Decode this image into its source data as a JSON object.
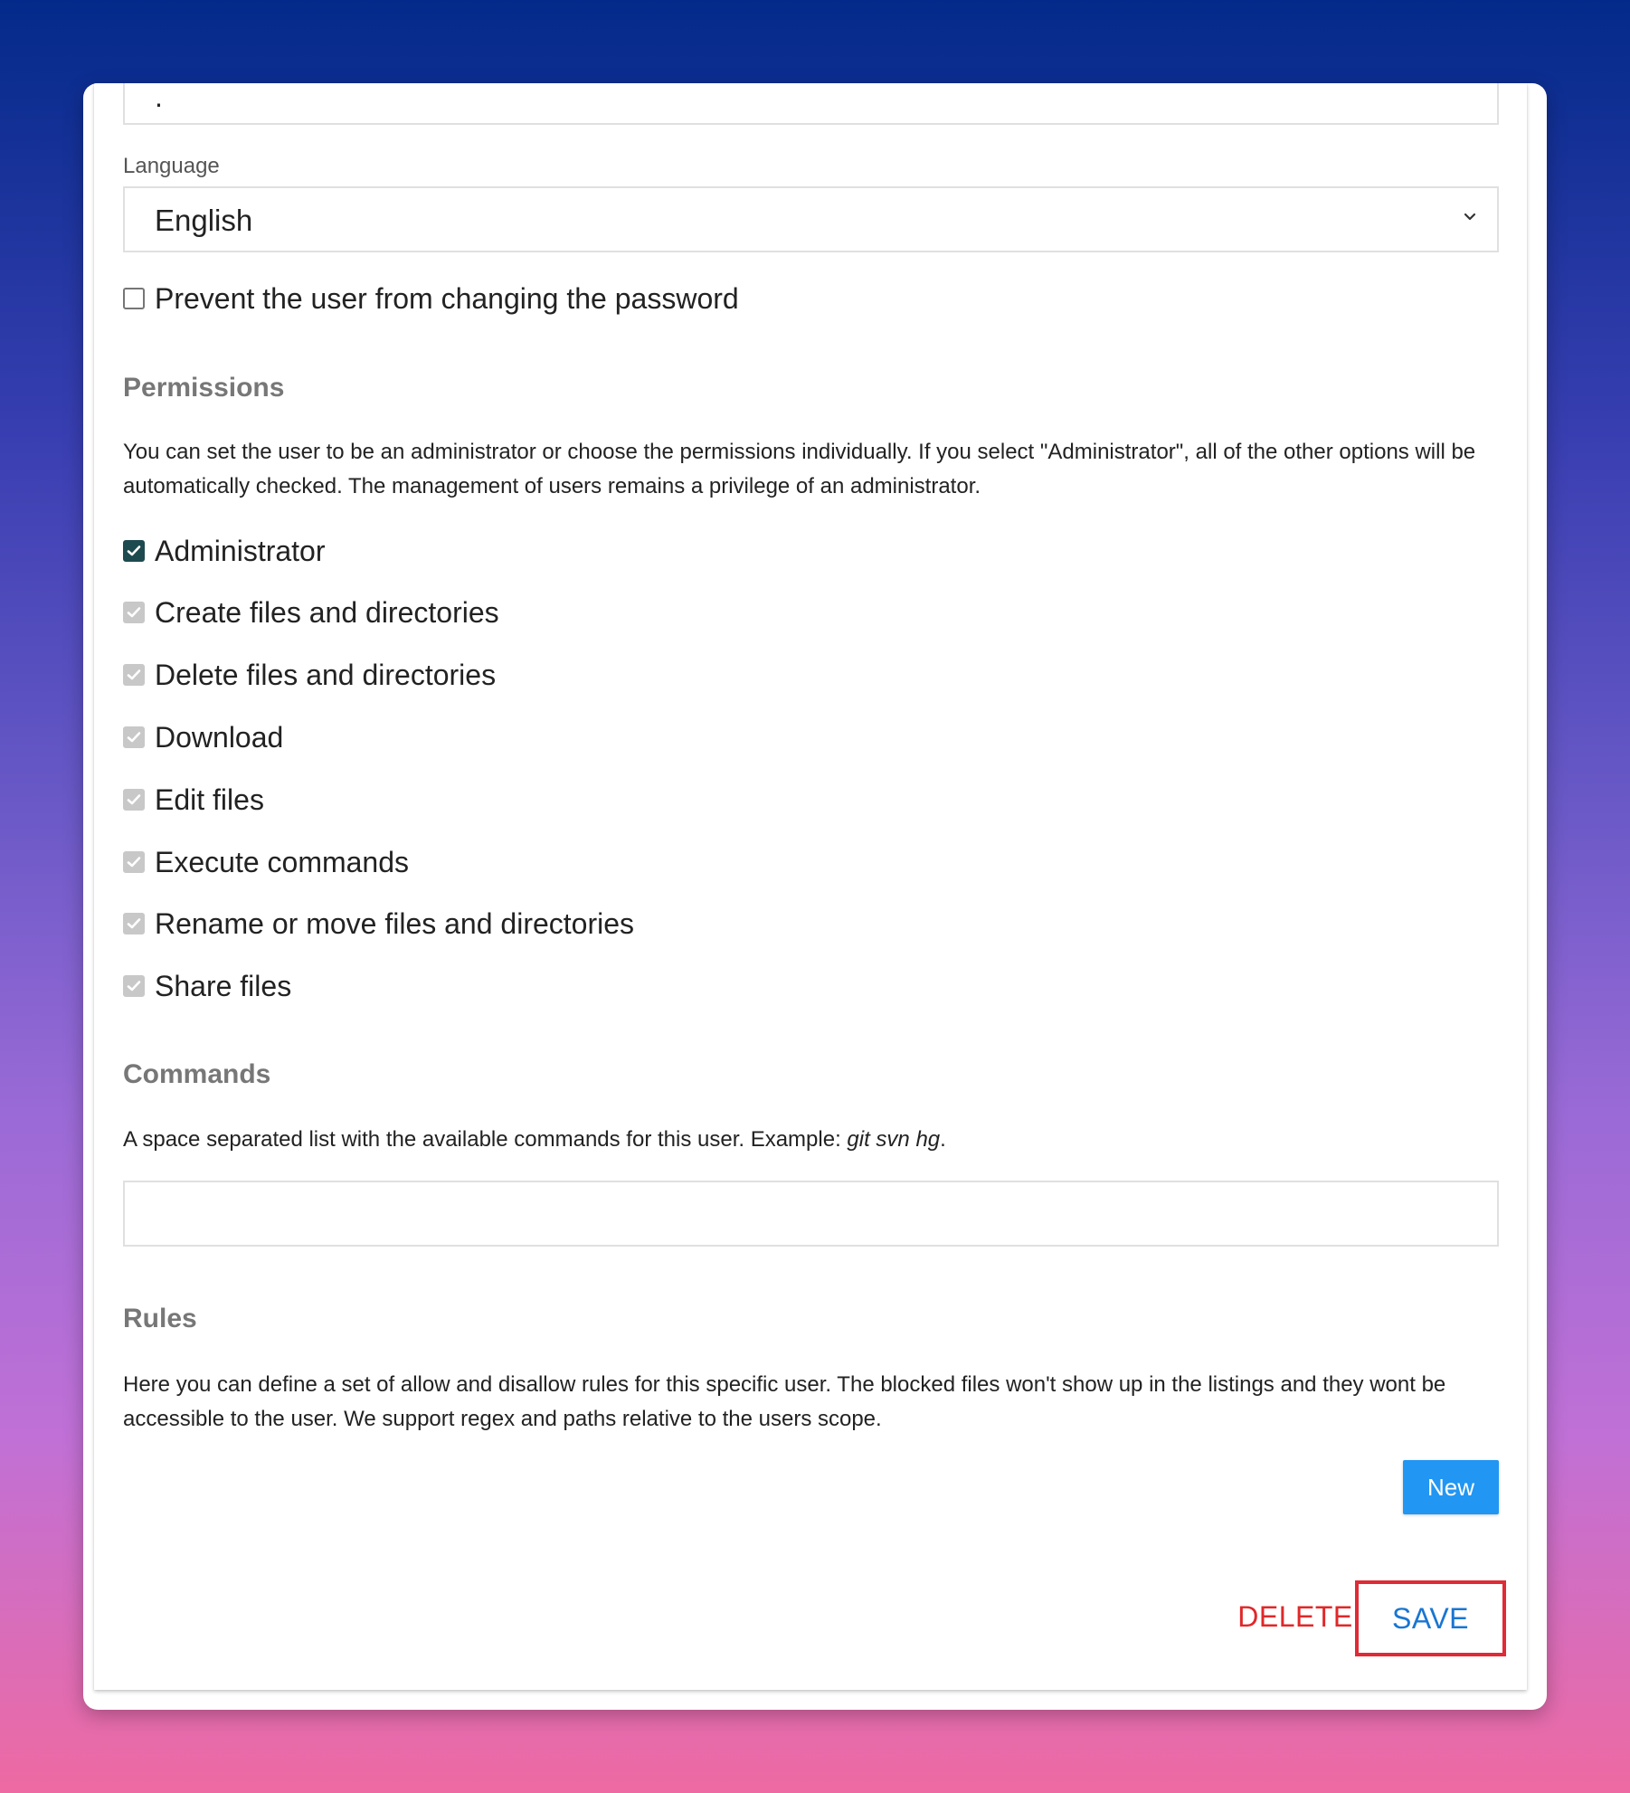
{
  "scope_input": {
    "value": "."
  },
  "language": {
    "label": "Language",
    "selected": "English",
    "icon": "chevron-down-icon"
  },
  "prevent_password_change": {
    "label": "Prevent the user from changing the password",
    "checked": false
  },
  "permissions": {
    "title": "Permissions",
    "description": "You can set the user to be an administrator or choose the permissions individually. If you select \"Administrator\", all of the other options will be automatically checked. The management of users remains a privilege of an administrator.",
    "items": [
      {
        "label": "Administrator",
        "checked": true,
        "disabled": false
      },
      {
        "label": "Create files and directories",
        "checked": true,
        "disabled": true
      },
      {
        "label": "Delete files and directories",
        "checked": true,
        "disabled": true
      },
      {
        "label": "Download",
        "checked": true,
        "disabled": true
      },
      {
        "label": "Edit files",
        "checked": true,
        "disabled": true
      },
      {
        "label": "Execute commands",
        "checked": true,
        "disabled": true
      },
      {
        "label": "Rename or move files and directories",
        "checked": true,
        "disabled": true
      },
      {
        "label": "Share files",
        "checked": true,
        "disabled": true
      }
    ]
  },
  "commands": {
    "title": "Commands",
    "description_prefix": "A space separated list with the available commands for this user. Example: ",
    "example": "git svn hg",
    "description_suffix": ".",
    "value": ""
  },
  "rules": {
    "title": "Rules",
    "description": "Here you can define a set of allow and disallow rules for this specific user. The blocked files won't show up in the listings and they wont be accessible to the user. We support regex and paths relative to the users scope.",
    "new_label": "New"
  },
  "actions": {
    "delete_label": "DELETE",
    "save_label": "SAVE"
  },
  "colors": {
    "primary": "#2196f3",
    "save_text": "#1976d2",
    "delete_text": "#e0282a",
    "highlight_border": "#e02a36",
    "checkbox_checked": "#1d4a4f"
  }
}
